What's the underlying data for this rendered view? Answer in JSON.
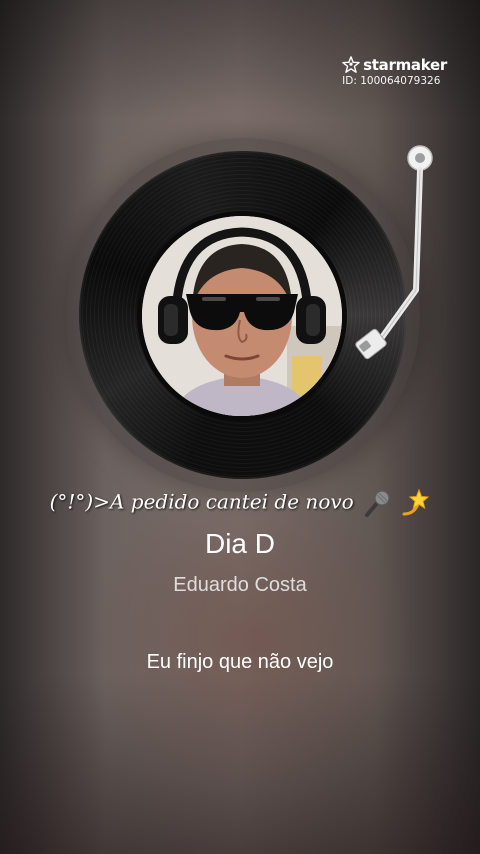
{
  "watermark": {
    "brand": "starmaker",
    "id_text": "ID: 100064079326",
    "logo_icon": "star-person-icon"
  },
  "record": {
    "disc_icon": "vinyl-record",
    "avatar_icon": "user-avatar-photo",
    "tonearm_icon": "tonearm"
  },
  "caption": {
    "text": "(°!°)>A pedido cantei de novo",
    "emojis": [
      "microphone-icon",
      "dizzy-star-icon"
    ]
  },
  "song": {
    "title": "Dia D",
    "artist": "Eduardo Costa"
  },
  "lyrics": {
    "current_line": "Eu finjo que não vejo"
  },
  "colors": {
    "text_primary": "#ffffff",
    "record_black": "#0e0e0e"
  }
}
